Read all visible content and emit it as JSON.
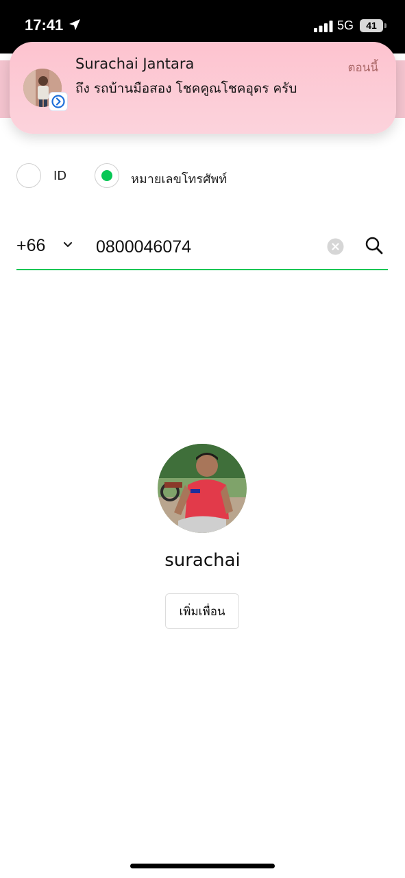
{
  "status_bar": {
    "time": "17:41",
    "network": "5G",
    "battery": "41"
  },
  "notification": {
    "sender": "Surachai Jantara",
    "time": "ตอนนี้",
    "message": "ถึง รถบ้านมือสอง โชคคูณโชคอุดร ครับ"
  },
  "search_type": {
    "options": [
      {
        "label": "ID",
        "selected": false
      },
      {
        "label": "หมายเลขโทรศัพท์",
        "selected": true
      }
    ]
  },
  "phone_search": {
    "country_code": "+66",
    "number": "0800046074"
  },
  "result": {
    "name": "surachai",
    "add_button_label": "เพิ่มเพื่อน"
  },
  "colors": {
    "accent": "#07c755",
    "notification_bg": "#fdc3cf"
  }
}
